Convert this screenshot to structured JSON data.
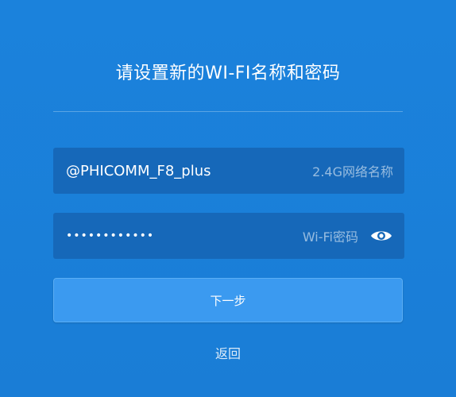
{
  "page": {
    "title": "请设置新的WI-FI名称和密码"
  },
  "colors": {
    "background": "#1a7ed8",
    "field_background": "#1668b9",
    "button_background": "#3b9af0",
    "text": "#ffffff"
  },
  "form": {
    "ssid": {
      "value": "@PHICOMM_F8_plus",
      "hint": "2.4G网络名称"
    },
    "password": {
      "value": "••••••••••••",
      "hint": "Wi-Fi密码",
      "toggle_icon": "eye-icon"
    },
    "next_label": "下一步",
    "back_label": "返回"
  }
}
